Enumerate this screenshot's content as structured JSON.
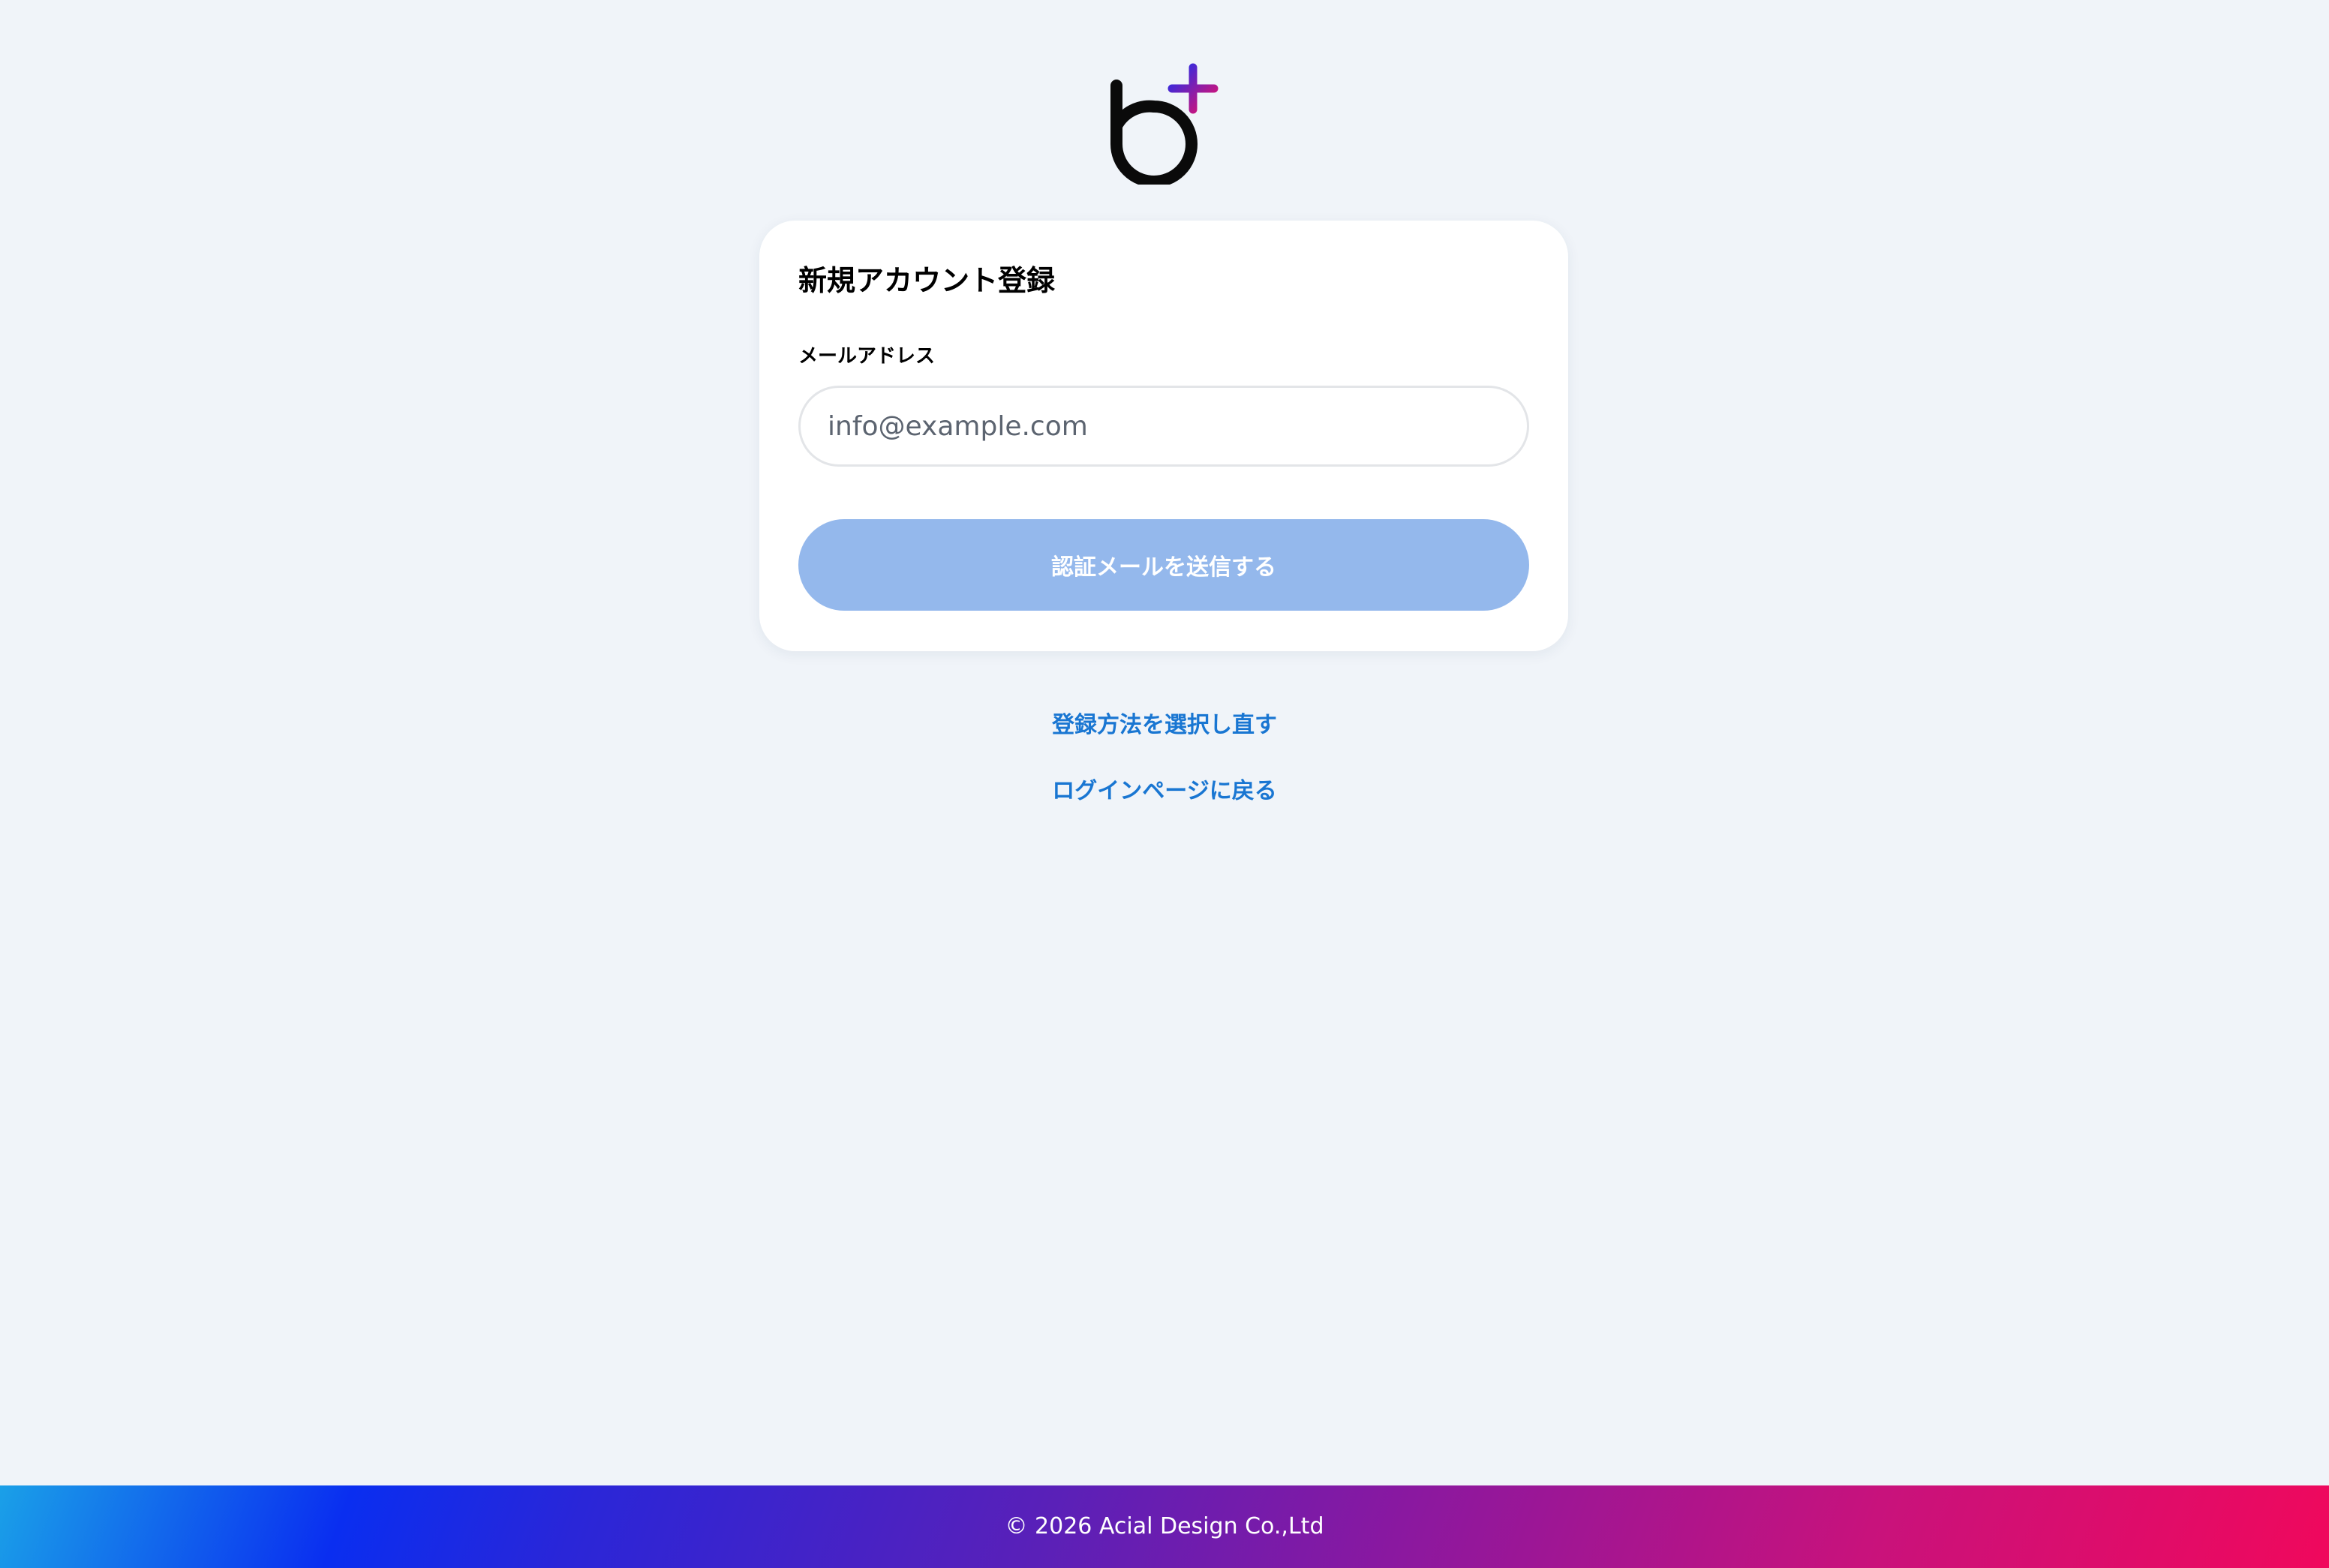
{
  "brand": {
    "logo_icon": "b-plus-logo",
    "logo_colors": {
      "letter": "#0a0a0a",
      "plus_start": "#1a2ef0",
      "plus_end": "#e8106a"
    }
  },
  "signup_card": {
    "title": "新規アカウント登録",
    "email_label": "メールアドレス",
    "email_value": "",
    "email_placeholder": "info@example.com",
    "submit_label": "認証メールを送信する",
    "submit_disabled": true
  },
  "links": {
    "reselect_method": "登録方法を選択し直す",
    "back_to_login": "ログインページに戻る"
  },
  "footer": {
    "copyright": "© 2026 Acial Design Co.,Ltd"
  },
  "colors": {
    "background": "#f0f4f9",
    "card": "#ffffff",
    "button_disabled": "#94b8ec",
    "link": "#1976d2",
    "footer_gradient_start": "#1aa0e8",
    "footer_gradient_end": "#f0085c"
  }
}
